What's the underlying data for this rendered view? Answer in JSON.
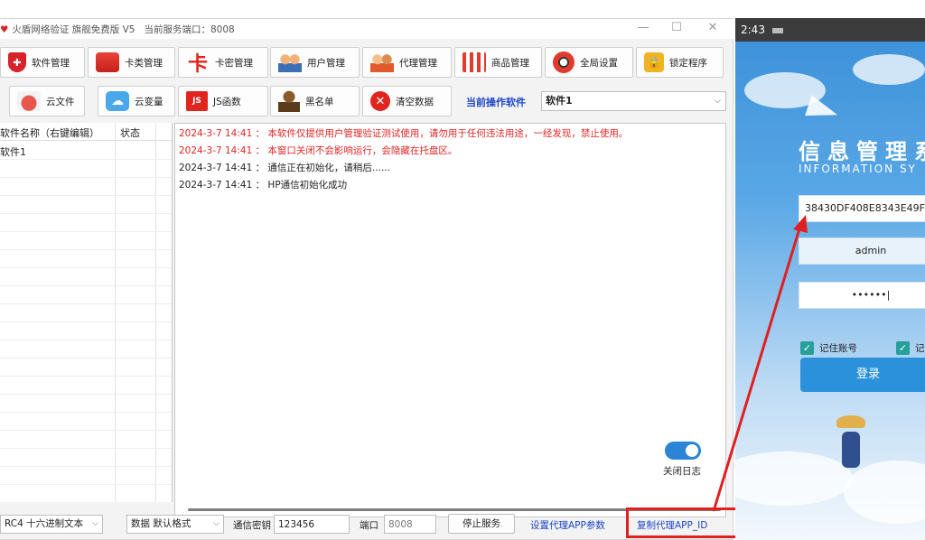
{
  "window": {
    "title": "火盾网络验证 旗舰免费版 V5",
    "port_status": "当前服务端口：8008",
    "controls": {
      "minimize": "—",
      "maximize": "☐",
      "close": "✕"
    }
  },
  "toolbar": {
    "row1": [
      {
        "id": "software",
        "label": "软件管理",
        "icon": "shield-icon"
      },
      {
        "id": "cardtype",
        "label": "卡类管理",
        "icon": "card-type-icon"
      },
      {
        "id": "cardkey",
        "label": "卡密管理",
        "icon": "card-key-icon"
      },
      {
        "id": "user",
        "label": "用户管理",
        "icon": "users-icon"
      },
      {
        "id": "agent",
        "label": "代理管理",
        "icon": "agent-icon"
      },
      {
        "id": "goods",
        "label": "商品管理",
        "icon": "shop-icon"
      },
      {
        "id": "global",
        "label": "全局设置",
        "icon": "gear-icon"
      },
      {
        "id": "lock",
        "label": "锁定程序",
        "icon": "lock-icon"
      }
    ],
    "row2": [
      {
        "id": "cloudfile",
        "label": "云文件",
        "icon": "cloud-file-icon"
      },
      {
        "id": "cloudvar",
        "label": "云变量",
        "icon": "cloud-variable-icon"
      },
      {
        "id": "jsfunc",
        "label": "JS函数",
        "icon": "js-icon"
      },
      {
        "id": "blacklist",
        "label": "黑名单",
        "icon": "blacklist-icon"
      },
      {
        "id": "cleardata",
        "label": "清空数据",
        "icon": "clear-icon"
      }
    ],
    "ka_glyph": "卡",
    "js_glyph": "JS",
    "clear_glyph": "✕",
    "lock_glyph": "🔒",
    "cloud_glyph": "☁"
  },
  "current_software": {
    "label": "当前操作软件",
    "value": "软件1",
    "arrow": "⌵"
  },
  "software_table": {
    "headers": [
      "软件名称（右键编辑）",
      "状态"
    ],
    "rows": [
      {
        "name": "软件1",
        "status": ""
      }
    ]
  },
  "log": [
    {
      "text": "2024-3-7 14:41 ： 本软件仅提供用户管理验证测试使用，请勿用于任何违法用途，一经发现，禁止使用。",
      "color": "red"
    },
    {
      "text": "2024-3-7 14:41 ： 本窗口关闭不会影响运行，会隐藏在托盘区。",
      "color": "red"
    },
    {
      "text": "2024-3-7 14:41 ： 通信正在初始化，请稍后......",
      "color": "black"
    },
    {
      "text": "2024-3-7 14:41 ： HP通信初始化成功",
      "color": "black"
    }
  ],
  "log_toggle": {
    "label": "关闭日志",
    "on": true
  },
  "bottom": {
    "encrypt_mode": "RC4 十六进制文本",
    "data_format": "数据 默认格式",
    "key_label": "通信密钥",
    "key_value": "123456",
    "port_label": "端口",
    "port_value": "8008",
    "stop_button": "停止服务",
    "set_agent_link": "设置代理APP参数",
    "copy_agent_link": "复制代理APP_ID",
    "arrow": "⌵"
  },
  "phone": {
    "time": "2:43",
    "title": "信息管理系",
    "subtitle": "INFORMATION SY",
    "app_id": "38430DF408E8343E49F",
    "username": "admin",
    "password": "••••••|",
    "remember_account": "记住账号",
    "remember_other": "记",
    "check_glyph": "✓",
    "login_button": "登录"
  },
  "colors": {
    "accent_blue": "#1f46c8",
    "log_red": "#e02424",
    "highlight_red": "#e02020",
    "phone_login": "#2b91db",
    "toggle_on": "#2b84d6"
  }
}
